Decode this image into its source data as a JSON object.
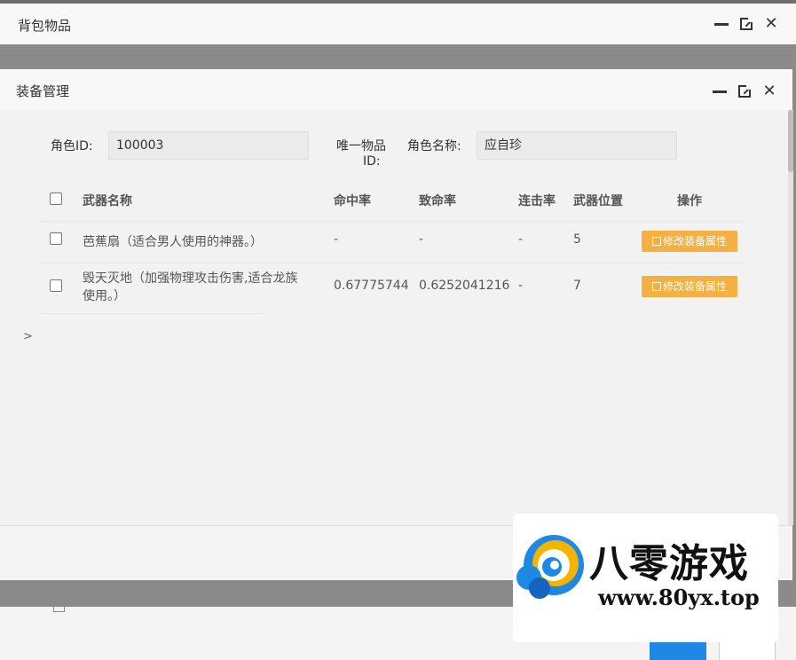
{
  "outer_window": {
    "title": "背包物品",
    "controls": {
      "minimize": "minimize-icon",
      "maximize": "maximize-icon",
      "close": "close-icon"
    }
  },
  "inner_window": {
    "title": "装备管理",
    "form": {
      "role_id_label": "角色ID:",
      "role_id_value": "100003",
      "item_id_label_line1": "唯一物品",
      "item_id_label_line2": "ID:",
      "role_name_label": "角色名称:",
      "role_name_value": "应自珍"
    },
    "table": {
      "columns": [
        "武器名称",
        "命中率",
        "致命率",
        "连击率",
        "武器位置",
        "操作"
      ],
      "rows": [
        {
          "name_line1": "芭蕉扇（适合男人使用的神器。）",
          "name_line2": "",
          "hit": "-",
          "crit": "-",
          "combo": "-",
          "pos": "5",
          "action": "修改装备属性"
        },
        {
          "name_line1": "毁天灭地（加强物理攻击伤害,适合龙族",
          "name_line2": "使用。）",
          "hit": "0.67775744",
          "crit": "0.6252041216",
          "combo": "-",
          "pos": "7",
          "action": "修改装备属性"
        }
      ]
    },
    "expander": ">"
  },
  "watermark": {
    "logo": "swirl-logo-icon",
    "name": "八零游戏",
    "url": "www.80yx.top"
  },
  "colors": {
    "action_button": "#f5a623",
    "primary_button": "#1e88e5"
  }
}
